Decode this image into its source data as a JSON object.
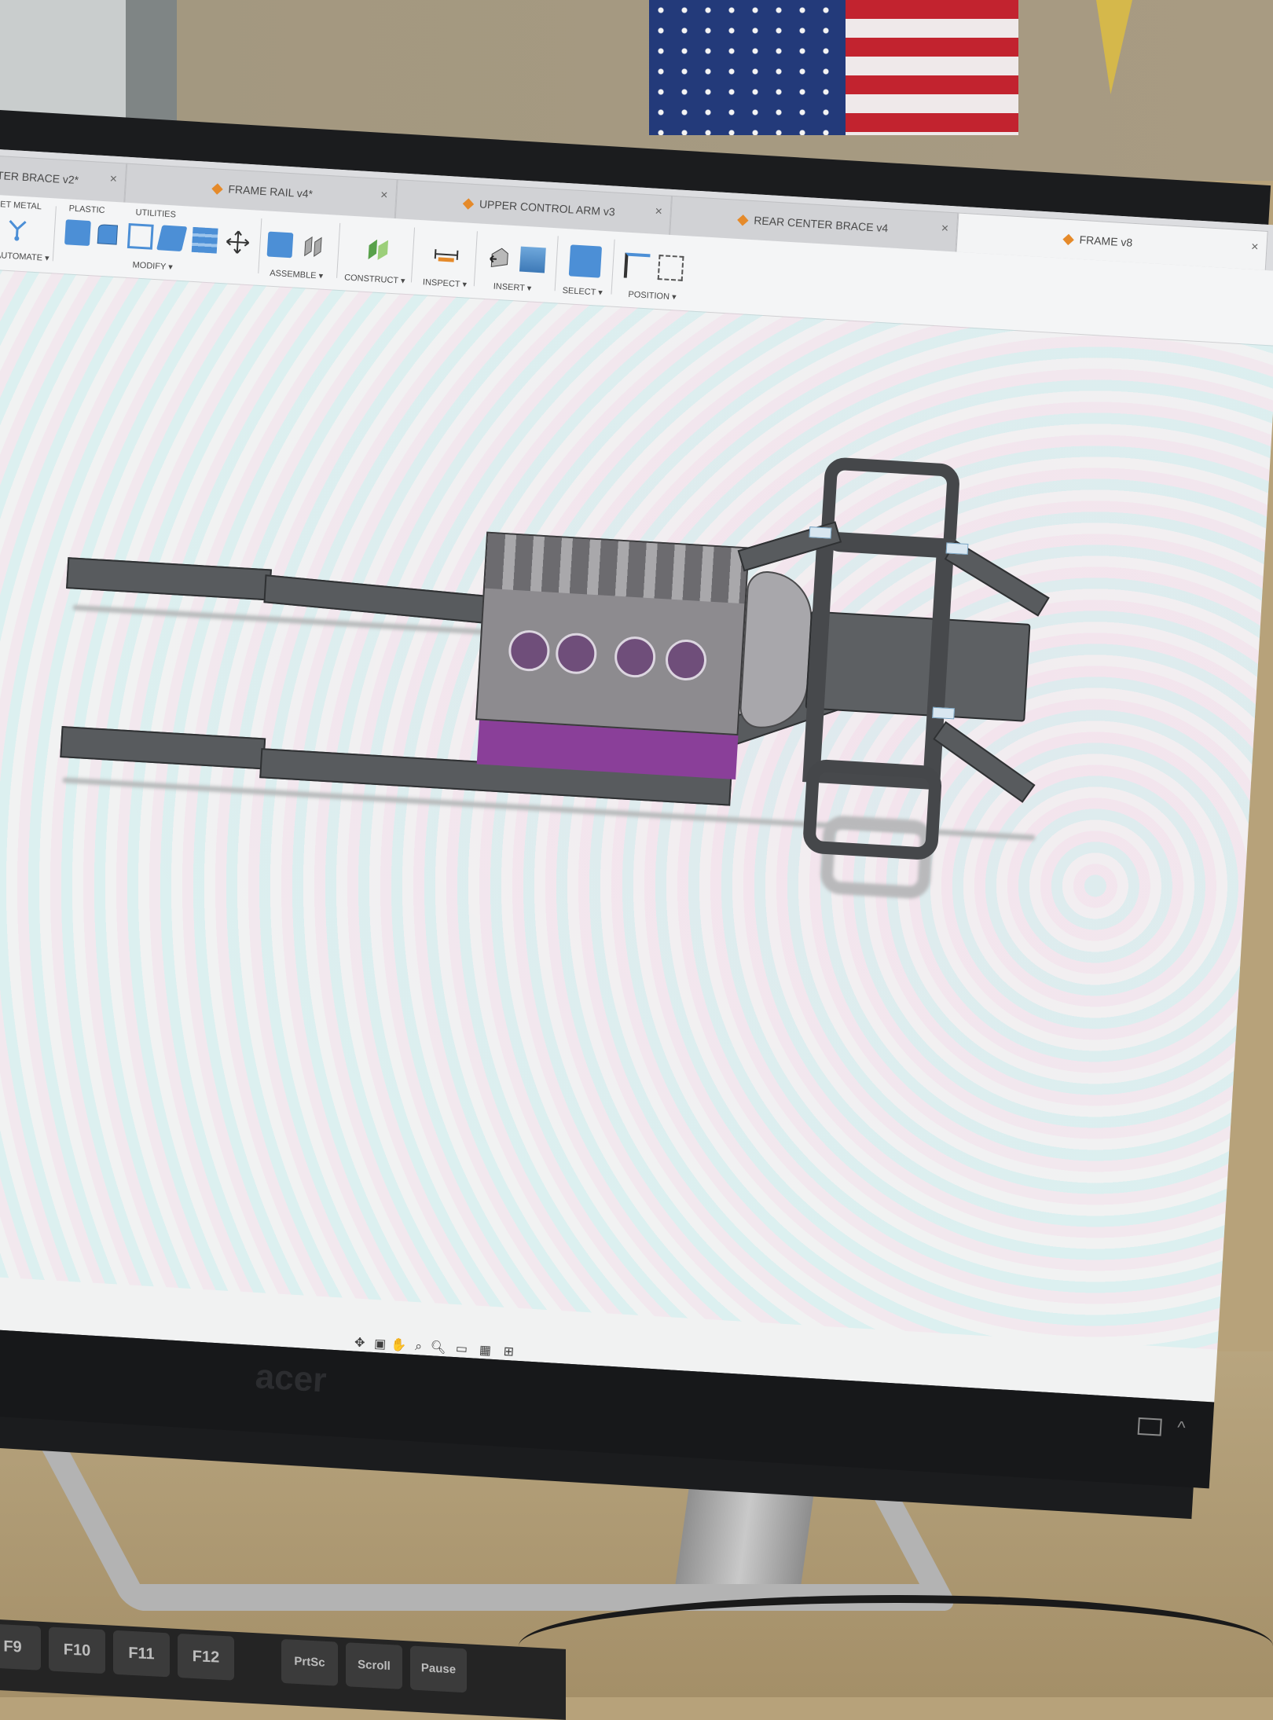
{
  "tabs": [
    {
      "label": "TER BRACE v2*",
      "active": false
    },
    {
      "label": "FRAME RAIL v4*",
      "active": false
    },
    {
      "label": "UPPER CONTROL ARM v3",
      "active": false
    },
    {
      "label": "REAR CENTER BRACE v4",
      "active": false
    },
    {
      "label": "FRAME v8",
      "active": true
    }
  ],
  "toolbar": {
    "group_sheet_metal": "EET METAL",
    "group_plastic": "PLASTIC",
    "group_utilities": "UTILITIES",
    "automate": "AUTOMATE ▾",
    "modify": "MODIFY ▾",
    "assemble": "ASSEMBLE ▾",
    "construct": "CONSTRUCT ▾",
    "inspect": "INSPECT ▾",
    "insert": "INSERT ▾",
    "select": "SELECT ▾",
    "position": "POSITION ▾"
  },
  "monitor": {
    "brand": "acer"
  },
  "keyboard": {
    "keys": [
      "F9",
      "F10",
      "F11",
      "F12",
      "PrtSc",
      "Scroll",
      "Pause"
    ]
  },
  "icons": {
    "tab_component": "component-cube-icon",
    "close": "close-icon",
    "orbit": "orbit-icon",
    "pan": "pan-hand-icon",
    "zoom": "zoom-icon",
    "display": "display-settings-icon",
    "grid": "grid-icon",
    "viewports": "viewports-icon"
  },
  "colors": {
    "component_icon": "#e58a2a",
    "select_tool": "#4c8fd6",
    "engine_sump": "#8a3f99"
  }
}
